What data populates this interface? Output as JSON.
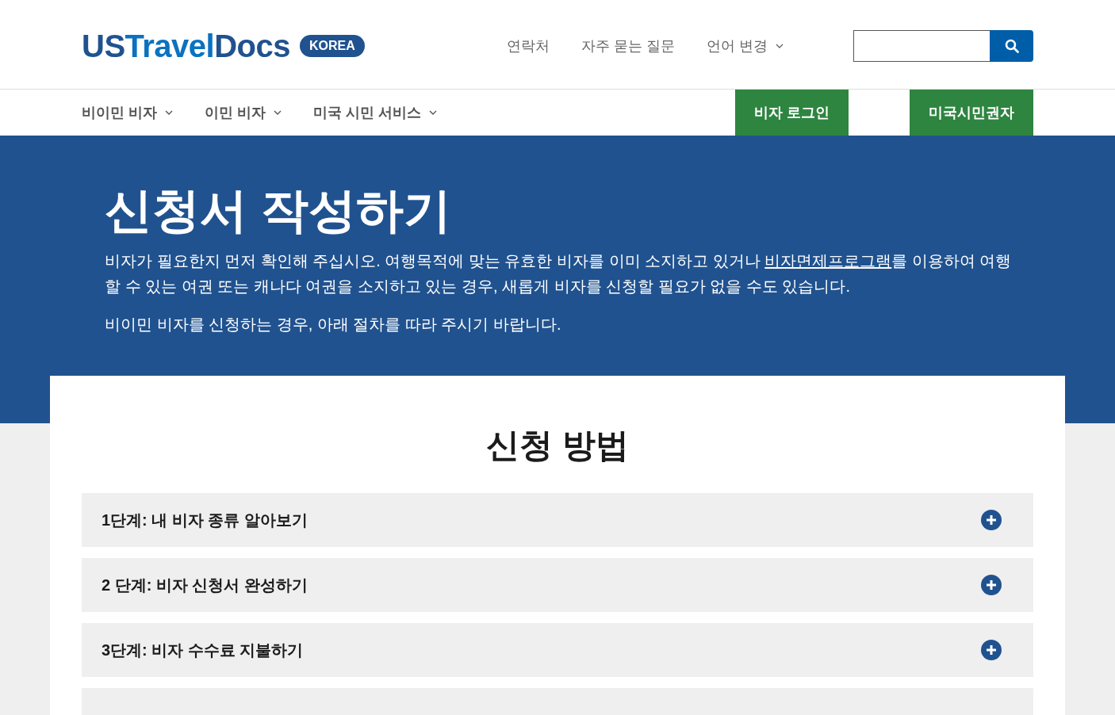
{
  "logo": {
    "name_parts": [
      "US",
      "Travel",
      "Docs"
    ],
    "badge": "KOREA"
  },
  "top_links": [
    {
      "label": "연락처",
      "dropdown": false
    },
    {
      "label": "자주 묻는 질문",
      "dropdown": false
    },
    {
      "label": "언어 변경",
      "dropdown": true
    }
  ],
  "nav": [
    {
      "label": "비이민 비자"
    },
    {
      "label": "이민 비자"
    },
    {
      "label": "미국 시민 서비스"
    }
  ],
  "nav_buttons": [
    "비자 로그인",
    "미국시민권자"
  ],
  "hero": {
    "title": "신청서 작성하기",
    "paragraphs": [
      {
        "before": "비자가 필요한지 먼저 확인해 주십시오. 여행목적에 맞는 유효한 비자를 이미 소지하고 있거나 ",
        "link": "비자면제프로그램",
        "after": "를 이용하여 여행할 수 있는 여권 또는 캐나다 여권을 소지하고 있는 경우, 새롭게 비자를 신청할 필요가 없을 수도 있습니다."
      },
      {
        "before": "비이민 비자를 신청하는 경우, 아래 절차를 따라 주시기 바랍니다."
      }
    ]
  },
  "steps": {
    "title": "신청 방법",
    "items": [
      {
        "label": "1단계: 내 비자 종류 알아보기",
        "expanded": false
      },
      {
        "label": "2 단계: 비자 신청서 완성하기",
        "expanded": false
      },
      {
        "label": "3단계: 비자 수수료 지불하기",
        "expanded": false
      },
      {
        "expanded": false
      }
    ]
  }
}
